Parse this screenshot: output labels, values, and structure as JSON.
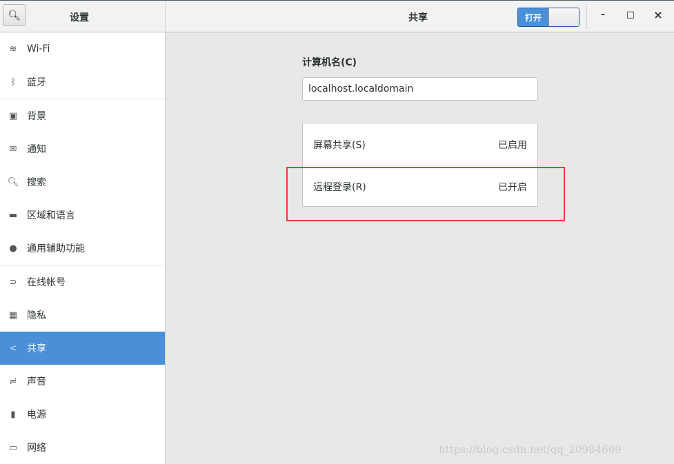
{
  "header": {
    "sidebar_title": "设置",
    "page_title": "共享",
    "switch_label": "打开",
    "minimize": "–",
    "maximize": "□",
    "close": "×"
  },
  "sidebar": {
    "items": [
      {
        "label": "Wi-Fi",
        "icon": "wifi-icon",
        "glyph": "≋"
      },
      {
        "label": "蓝牙",
        "icon": "bluetooth-icon",
        "glyph": "ᛒ"
      },
      {
        "label": "背景",
        "icon": "background-icon",
        "glyph": "▣"
      },
      {
        "label": "通知",
        "icon": "notification-icon",
        "glyph": "✉"
      },
      {
        "label": "搜索",
        "icon": "search-icon",
        "glyph": "🔍︎"
      },
      {
        "label": "区域和语言",
        "icon": "region-icon",
        "glyph": "▬"
      },
      {
        "label": "通用辅助功能",
        "icon": "accessibility-icon",
        "glyph": "●"
      },
      {
        "label": "在线帐号",
        "icon": "online-accounts-icon",
        "glyph": "⊃"
      },
      {
        "label": "隐私",
        "icon": "privacy-icon",
        "glyph": "▦"
      },
      {
        "label": "共享",
        "icon": "share-icon",
        "glyph": "<"
      },
      {
        "label": "声音",
        "icon": "sound-icon",
        "glyph": "≓"
      },
      {
        "label": "电源",
        "icon": "power-icon",
        "glyph": "▮"
      },
      {
        "label": "网络",
        "icon": "network-icon",
        "glyph": "▭"
      }
    ]
  },
  "main": {
    "hostname_label": "计算机名(C)",
    "hostname_value": "localhost.localdomain",
    "rows": [
      {
        "label": "屏幕共享(S)",
        "status": "已启用"
      },
      {
        "label": "远程登录(R)",
        "status": "已开启"
      }
    ]
  },
  "watermark": "https://blog.csdn.net/qq_20984609"
}
